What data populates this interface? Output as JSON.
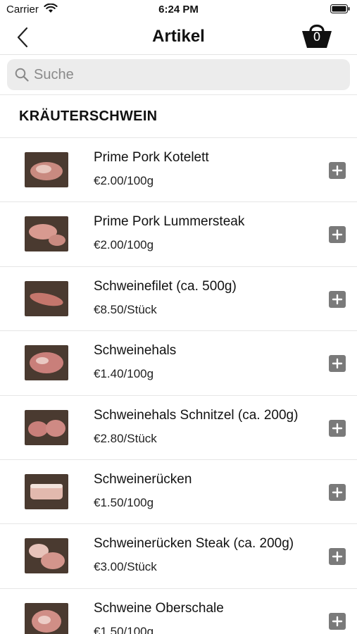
{
  "status_bar": {
    "carrier": "Carrier",
    "time": "6:24 PM"
  },
  "nav": {
    "title": "Artikel",
    "cart_count": "0"
  },
  "search": {
    "placeholder": "Suche",
    "value": ""
  },
  "section": {
    "title": "KRÄUTERSCHWEIN"
  },
  "products": [
    {
      "name": "Prime Pork Kotelett",
      "price": "€2.00/100g"
    },
    {
      "name": "Prime Pork Lummersteak",
      "price": "€2.00/100g"
    },
    {
      "name": "Schweinefilet (ca. 500g)",
      "price": "€8.50/Stück"
    },
    {
      "name": "Schweinehals",
      "price": "€1.40/100g"
    },
    {
      "name": "Schweinehals Schnitzel (ca. 200g)",
      "price": "€2.80/Stück"
    },
    {
      "name": "Schweinerücken",
      "price": "€1.50/100g"
    },
    {
      "name": "Schweinerücken Steak (ca. 200g)",
      "price": "€3.00/Stück"
    },
    {
      "name": "Schweine Oberschale",
      "price": "€1.50/100g"
    }
  ],
  "colors": {
    "add_button": "#7a7a7a",
    "search_bg": "#ececec",
    "divider": "#e6e6e6",
    "meat": "#c98a80",
    "thumb_bg": "#4a3a30"
  },
  "icons": {
    "back": "chevron-left-icon",
    "cart": "shopping-basket-icon",
    "search": "magnifier-icon",
    "add": "plus-square-icon"
  }
}
